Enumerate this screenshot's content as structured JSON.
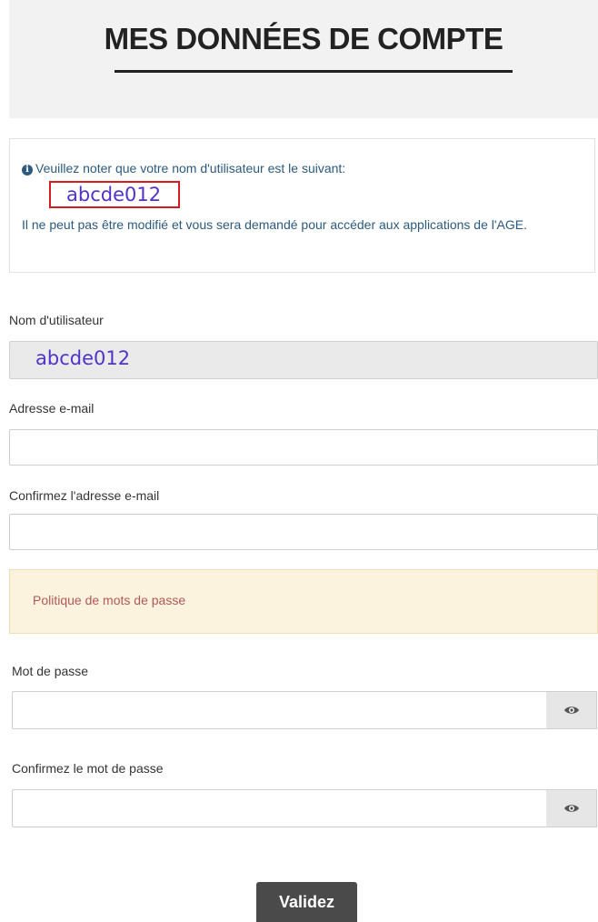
{
  "header": {
    "title": "MES DONNÉES DE COMPTE"
  },
  "info": {
    "icon": "info-circle-icon",
    "line1": "Veuillez noter que votre nom d'utilisateur est le suivant:",
    "username": "abcde012",
    "line2": "Il ne peut pas être modifié et vous sera demandé pour accéder aux applications de l'AGE."
  },
  "form": {
    "username_label": "Nom d'utilisateur",
    "username_value": "abcde012",
    "email_label": "Adresse e-mail",
    "email_value": "",
    "email_confirm_label": "Confirmez l'adresse e-mail",
    "email_confirm_value": "",
    "password_policy": "Politique de mots de passe",
    "password_label": "Mot de passe",
    "password_value": "",
    "password_confirm_label": "Confirmez le mot de passe",
    "password_confirm_value": "",
    "submit_label": "Validez"
  },
  "colors": {
    "info_text": "#2c5a7e",
    "highlight_border": "#d21d22",
    "username_text": "#5233c8",
    "policy_bg": "#fcf3de",
    "policy_text": "#b3575a",
    "submit_bg": "#4a4a4a"
  }
}
